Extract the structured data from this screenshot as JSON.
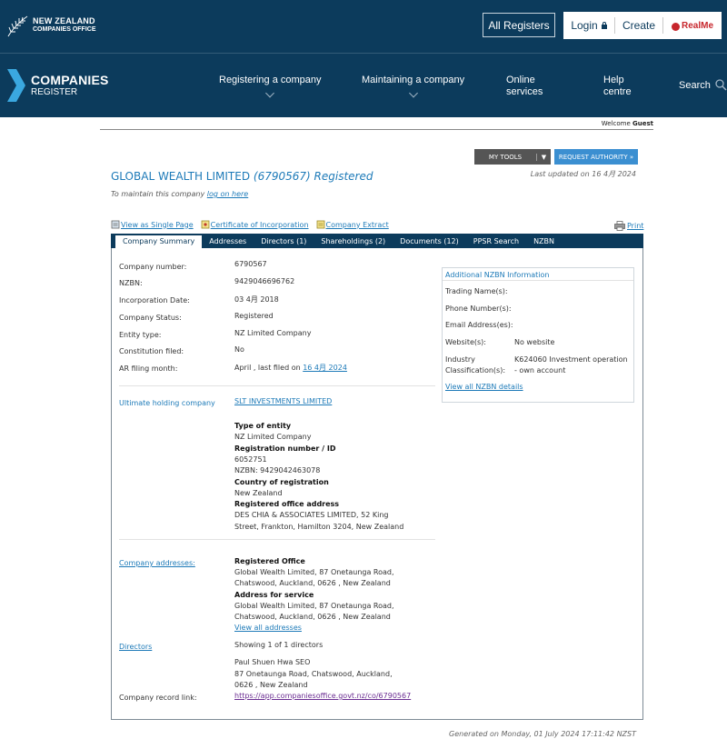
{
  "header": {
    "nz_logo_line1": "NEW ZEALAND",
    "nz_logo_line2": "COMPANIES OFFICE",
    "all_registers": "All Registers",
    "login": "Login",
    "create": "Create",
    "realme": "RealMe"
  },
  "nav": {
    "logo_line1": "COMPANIES",
    "logo_line2": "REGISTER",
    "items": [
      {
        "line1": "Registering a company",
        "line2": ""
      },
      {
        "line1": "Maintaining a company",
        "line2": ""
      },
      {
        "line1": "Online",
        "line2": "services"
      },
      {
        "line1": "Help",
        "line2": "centre"
      }
    ],
    "search": "Search"
  },
  "welcome": {
    "prefix": "Welcome",
    "user": "Guest"
  },
  "tools": {
    "my_tools": "MY TOOLS",
    "request_authority": "REQUEST AUTHORITY »"
  },
  "company": {
    "name": "GLOBAL WEALTH LIMITED",
    "number_status": "(6790567) Registered",
    "last_updated": "Last updated on 16 4月 2024",
    "maintain_prefix": "To maintain this company",
    "maintain_link": "log on here"
  },
  "links": {
    "single_page": "View as Single Page",
    "certificate": "Certificate of Incorporation",
    "extract": "Company Extract",
    "print": "Print"
  },
  "tabs": [
    "Company Summary",
    "Addresses",
    "Directors (1)",
    "Shareholdings (2)",
    "Documents (12)",
    "PPSR Search",
    "NZBN"
  ],
  "summary": {
    "company_number_label": "Company number:",
    "company_number": "6790567",
    "nzbn_label": "NZBN:",
    "nzbn": "9429046696762",
    "incorporation_label": "Incorporation Date:",
    "incorporation": "03 4月 2018",
    "status_label": "Company Status:",
    "status": "Registered",
    "entity_label": "Entity type:",
    "entity": "NZ Limited Company",
    "constitution_label": "Constitution filed:",
    "constitution": "No",
    "ar_label": "AR filing month:",
    "ar_prefix": "April , last filed on",
    "ar_date": "16 4月 2024"
  },
  "ultimate": {
    "label": "Ultimate holding company",
    "name": "SLT INVESTMENTS LIMITED",
    "type_heading": "Type of entity",
    "type": "NZ Limited Company",
    "reg_heading": "Registration number / ID",
    "reg": "6052751",
    "nzbn": "NZBN: 9429042463078",
    "country_heading": "Country of registration",
    "country": "New Zealand",
    "office_heading": "Registered office address",
    "office_line1": "DES CHIA & ASSOCIATES LIMITED, 52 King",
    "office_line2": "Street, Frankton, Hamilton 3204, New Zealand"
  },
  "addresses": {
    "label": "Company addresses:",
    "registered_heading": "Registered Office",
    "registered_line1": "Global Wealth Limited, 87 Onetaunga Road,",
    "registered_line2": "Chatswood, Auckland, 0626 , New Zealand",
    "service_heading": "Address for service",
    "service_line1": "Global Wealth Limited, 87 Onetaunga Road,",
    "service_line2": "Chatswood, Auckland, 0626 , New Zealand",
    "view_all": "View all addresses"
  },
  "directors": {
    "label": "Directors",
    "showing": "Showing 1 of 1 directors",
    "name": "Paul Shuen Hwa SEO",
    "addr_line1": "87 Onetaunga Road, Chatswood, Auckland,",
    "addr_line2": "0626 , New Zealand"
  },
  "record": {
    "label": "Company record link:",
    "url": "https://app.companiesoffice.govt.nz/co/6790567"
  },
  "nzbn_info": {
    "heading": "Additional NZBN Information",
    "trading_label": "Trading Name(s):",
    "phone_label": "Phone Number(s):",
    "email_label": "Email Address(es):",
    "website_label": "Website(s):",
    "website": "No website",
    "industry_label1": "Industry",
    "industry_label2": "Classification(s):",
    "industry_line1": "K624060 Investment operation",
    "industry_line2": "- own account",
    "view_all": "View all NZBN details"
  },
  "footer": {
    "generated": "Generated on Monday, 01 July 2024 17:11:42 NZST"
  }
}
